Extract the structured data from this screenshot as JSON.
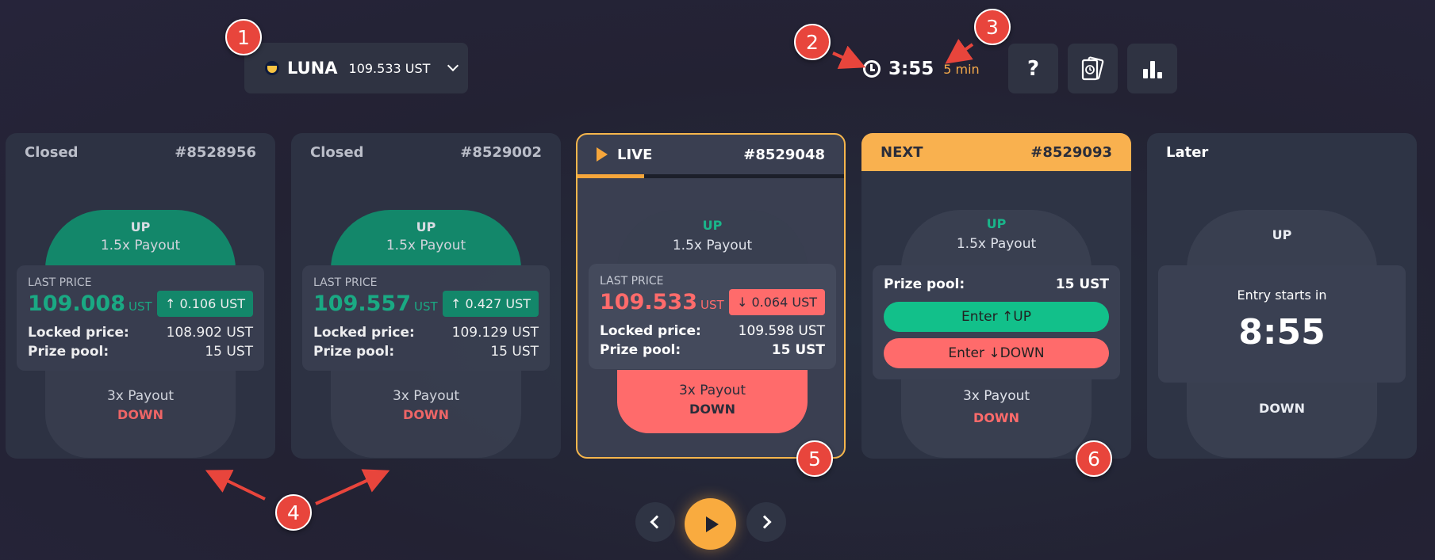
{
  "token": {
    "name": "LUNA",
    "price": "109.533 UST",
    "icon": "luna-icon"
  },
  "timer": {
    "time": "3:55",
    "interval": "5 min"
  },
  "top_buttons": {
    "help": "?",
    "history_icon": "history-cards-icon",
    "chart_icon": "bar-chart-icon"
  },
  "labels": {
    "last_price": "LAST PRICE",
    "locked_price": "Locked price:",
    "prize_pool": "Prize pool:",
    "up": "UP",
    "down": "DOWN",
    "entry_starts": "Entry starts in"
  },
  "cards": [
    {
      "status": "Closed",
      "epoch": "#8528956",
      "up_payout": "1.5x Payout",
      "down_payout": "3x Payout",
      "last_price": "109.008",
      "unit": "UST",
      "change": "↑ 0.106 UST",
      "locked_price": "108.902 UST",
      "prize_pool": "15 UST"
    },
    {
      "status": "Closed",
      "epoch": "#8529002",
      "up_payout": "1.5x Payout",
      "down_payout": "3x Payout",
      "last_price": "109.557",
      "unit": "UST",
      "change": "↑ 0.427 UST",
      "locked_price": "109.129 UST",
      "prize_pool": "15 UST"
    },
    {
      "status": "LIVE",
      "epoch": "#8529048",
      "up_payout": "1.5x Payout",
      "down_payout": "3x Payout",
      "last_price": "109.533",
      "unit": "UST",
      "change": "↓ 0.064 UST",
      "locked_price": "109.598 UST",
      "prize_pool": "15 UST",
      "progress": 0.25
    },
    {
      "status": "NEXT",
      "epoch": "#8529093",
      "up_payout": "1.5x Payout",
      "down_payout": "3x Payout",
      "prize_pool": "15 UST",
      "enter_up": "Enter ↑UP",
      "enter_down": "Enter ↓DOWN"
    },
    {
      "status": "Later",
      "entry_time": "8:55"
    }
  ],
  "annotations": [
    "1",
    "2",
    "3",
    "4",
    "5",
    "6"
  ],
  "colors": {
    "accent": "#f9ab3f",
    "bull": "#12906f",
    "bear": "#ff6b6b",
    "card": "#2e3445"
  }
}
